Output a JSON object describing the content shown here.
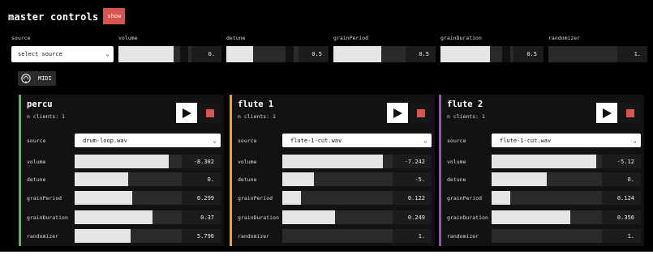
{
  "header": {
    "title": "master controls",
    "show_label": "show"
  },
  "master": {
    "labels": {
      "source": "source",
      "volume": "volume",
      "detune": "detune",
      "grainPeriod": "grainPeriod",
      "grainDuration": "grainDuration",
      "randomizer": "randomizer"
    },
    "source_value": "select source",
    "values": {
      "volume": "0.",
      "detune": "0.5",
      "grainPeriod": "0.5",
      "grainDuration": "0.5",
      "randomizer": "1."
    },
    "fractions": {
      "volume": 0.75,
      "detune": 0.37,
      "grainPeriod": 0.66,
      "grainDuration": 0.68,
      "randomizer": 0.0
    }
  },
  "midi_label": "MIDI",
  "colors": {
    "accent_red": "#d9534f",
    "panel_percu": "#5cb85c",
    "panel_flute1": "#f0a030",
    "panel_flute2": "#9b4dca"
  },
  "param_labels": {
    "source": "source",
    "volume": "volume",
    "detune": "detune",
    "grainPeriod": "grainPeriod",
    "grainDuration": "grainDuration",
    "randomizer": "randomizer"
  },
  "panels": [
    {
      "title": "percu",
      "clients": "n clients: 1",
      "source": "drum-loop.wav",
      "values": {
        "volume": "-8.302",
        "detune": "0.",
        "grainPeriod": "0.299",
        "grainDuration": "0.37",
        "randomizer": "5.796"
      },
      "fractions": {
        "volume": 0.88,
        "detune": 0.5,
        "grainPeriod": 0.54,
        "grainDuration": 0.73,
        "randomizer": 0.52
      }
    },
    {
      "title": "flute 1",
      "clients": "n clients: 1",
      "source": "flute-1-cut.wav",
      "values": {
        "volume": "-7.242",
        "detune": "-5.",
        "grainPeriod": "0.122",
        "grainDuration": "0.249",
        "randomizer": "1."
      },
      "fractions": {
        "volume": 0.91,
        "detune": 0.29,
        "grainPeriod": 0.17,
        "grainDuration": 0.48,
        "randomizer": 0.0
      }
    },
    {
      "title": "flute 2",
      "clients": "n clients: 1",
      "source": "flute-1-cut.wav",
      "values": {
        "volume": "-5.12",
        "detune": "0.",
        "grainPeriod": "0.124",
        "grainDuration": "0.356",
        "randomizer": "1."
      },
      "fractions": {
        "volume": 0.95,
        "detune": 0.5,
        "grainPeriod": 0.17,
        "grainDuration": 0.71,
        "randomizer": 0.0
      }
    }
  ]
}
